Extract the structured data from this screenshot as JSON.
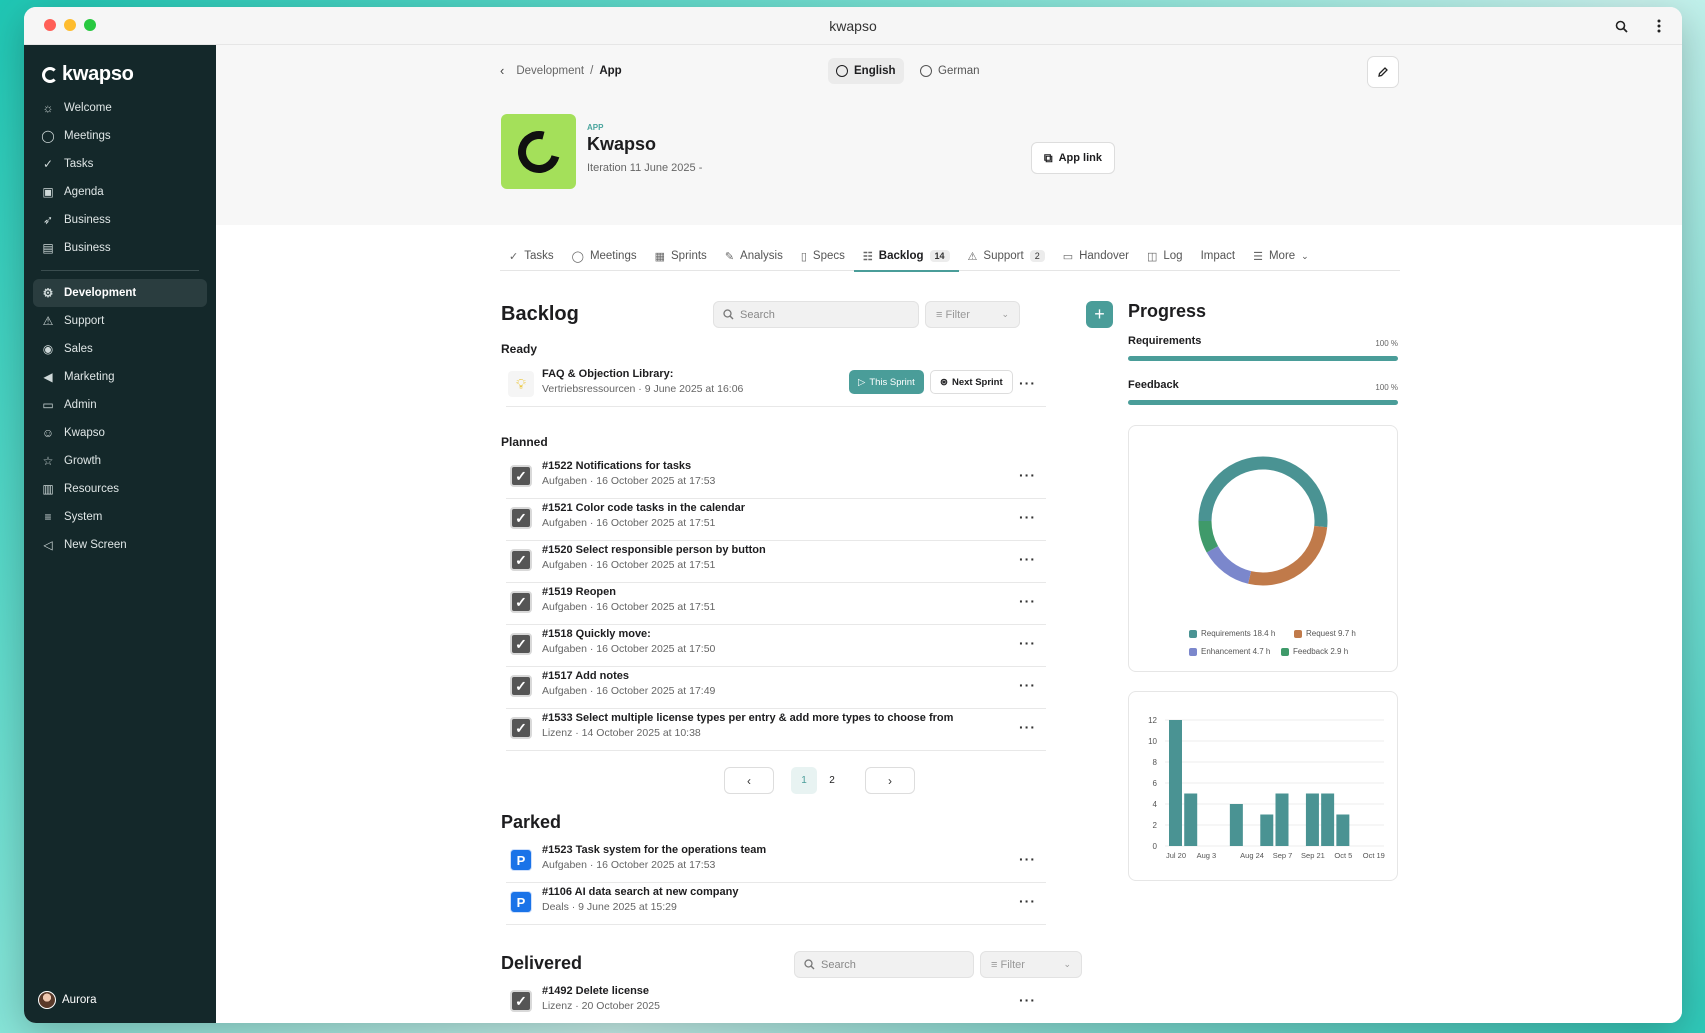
{
  "window": {
    "title": "kwapso"
  },
  "colors": {
    "accent": "#4a9d99",
    "sidebar": "#14282a",
    "app_logo_bg": "#a4e05a"
  },
  "sidebar": {
    "logo": "kwapso",
    "items": [
      {
        "label": "Welcome",
        "icon": "sun-icon"
      },
      {
        "label": "Meetings",
        "icon": "chat-bubble-icon"
      },
      {
        "label": "Tasks",
        "icon": "check-circle-icon"
      },
      {
        "label": "Agenda",
        "icon": "agenda-icon"
      },
      {
        "label": "Business",
        "icon": "rocket-icon"
      },
      {
        "label": "Business",
        "icon": "briefcase-icon"
      }
    ],
    "items2": [
      {
        "label": "Development",
        "icon": "gear-icon",
        "active": true
      },
      {
        "label": "Support",
        "icon": "warning-icon"
      },
      {
        "label": "Sales",
        "icon": "broadcast-icon"
      },
      {
        "label": "Marketing",
        "icon": "megaphone-icon"
      },
      {
        "label": "Admin",
        "icon": "folder-icon"
      },
      {
        "label": "Kwapso",
        "icon": "smiley-icon"
      },
      {
        "label": "Growth",
        "icon": "star-icon"
      },
      {
        "label": "Resources",
        "icon": "archive-icon"
      },
      {
        "label": "System",
        "icon": "sliders-icon"
      },
      {
        "label": "New Screen",
        "icon": "speaker-icon"
      }
    ],
    "user": "Aurora"
  },
  "header": {
    "breadcrumb": {
      "parent": "Development",
      "sep": "/",
      "current": "App"
    },
    "languages": [
      "English",
      "German"
    ],
    "app_tag": "APP",
    "app_name": "Kwapso",
    "iteration": "Iteration 11 June 2025 -",
    "app_link": "App link"
  },
  "tabs": [
    {
      "label": "Tasks",
      "icon": "check-circle-icon"
    },
    {
      "label": "Meetings",
      "icon": "chat-bubble-icon"
    },
    {
      "label": "Sprints",
      "icon": "calendar-icon"
    },
    {
      "label": "Analysis",
      "icon": "pencil-icon"
    },
    {
      "label": "Specs",
      "icon": "clipboard-icon"
    },
    {
      "label": "Backlog",
      "icon": "list-check-icon",
      "badge": "14",
      "active": true
    },
    {
      "label": "Support",
      "icon": "warning-icon",
      "badge": "2"
    },
    {
      "label": "Handover",
      "icon": "book-icon"
    },
    {
      "label": "Log",
      "icon": "comment-icon"
    },
    {
      "label": "Impact",
      "icon": ""
    },
    {
      "label": "More",
      "icon": "menu-icon"
    }
  ],
  "backlog": {
    "title": "Backlog",
    "search_placeholder": "Search",
    "filter_label": "Filter",
    "ready_label": "Ready",
    "ready": [
      {
        "title": "FAQ & Objection Library:",
        "sub": "Vertriebsressourcen · 9 June 2025 at 16:06",
        "this_sprint": "This Sprint",
        "next_sprint": "Next Sprint"
      }
    ],
    "planned_label": "Planned",
    "planned": [
      {
        "title": "#1522 Notifications for tasks",
        "sub": "Aufgaben · 16 October 2025 at 17:53"
      },
      {
        "title": "#1521 Color code tasks in the calendar",
        "sub": "Aufgaben · 16 October 2025 at 17:51"
      },
      {
        "title": "#1520 Select responsible person by button",
        "sub": "Aufgaben · 16 October 2025 at 17:51"
      },
      {
        "title": "#1519 Reopen",
        "sub": "Aufgaben · 16 October 2025 at 17:51"
      },
      {
        "title": "#1518 Quickly move:",
        "sub": "Aufgaben · 16 October 2025 at 17:50"
      },
      {
        "title": "#1517 Add notes",
        "sub": "Aufgaben · 16 October 2025 at 17:49"
      },
      {
        "title": "#1533 Select multiple license types per entry & add more types to choose from",
        "sub": "Lizenz · 14 October 2025 at 10:38"
      }
    ],
    "pages": [
      "1",
      "2"
    ],
    "parked_label": "Parked",
    "parked": [
      {
        "title": "#1523 Task system for the operations team",
        "sub": "Aufgaben · 16 October 2025 at 17:53"
      },
      {
        "title": "#1106 AI data search at new company",
        "sub": "Deals · 9 June 2025 at 15:29"
      }
    ],
    "delivered_label": "Delivered",
    "delivered_search": "Search",
    "delivered_filter": "Filter",
    "delivered": [
      {
        "title": "#1492 Delete license",
        "sub": "Lizenz · 20 October 2025"
      }
    ]
  },
  "progress": {
    "title": "Progress",
    "bars": [
      {
        "label": "Requirements",
        "value": "100 %",
        "fraction": 1.0
      },
      {
        "label": "Feedback",
        "value": "100 %",
        "fraction": 1.0
      }
    ]
  },
  "chart_data": [
    {
      "type": "pie",
      "donut": true,
      "slices": [
        {
          "name": "Requirements 18.4 h",
          "value": 18.4,
          "color": "#4a9393"
        },
        {
          "name": "Request 9.7 h",
          "value": 9.7,
          "color": "#c07a4a"
        },
        {
          "name": "Enhancement 4.7 h",
          "value": 4.7,
          "color": "#7b87cc"
        },
        {
          "name": "Feedback 2.9 h",
          "value": 2.9,
          "color": "#3f9a6a"
        }
      ]
    },
    {
      "type": "bar",
      "x": [
        "Jul 20",
        "Jul 27",
        "Aug 3",
        "Aug 10",
        "Aug 17",
        "Aug 24",
        "Aug 31",
        "Sep 7",
        "Sep 14",
        "Sep 21",
        "Sep 28",
        "Oct 5",
        "Oct 12",
        "Oct 19"
      ],
      "tick_labels": [
        "Jul 20",
        "",
        "Aug 3",
        "",
        "",
        "Aug 24",
        "",
        "Sep 7",
        "",
        "Sep 21",
        "",
        "Oct 5",
        "",
        "Oct 19"
      ],
      "values": [
        12,
        5,
        0,
        0,
        4,
        0,
        3,
        5,
        0,
        5,
        5,
        3,
        0,
        0
      ],
      "ylim": [
        0,
        12
      ],
      "yticks": [
        "0",
        "2",
        "4",
        "6",
        "8",
        "10",
        "12"
      ],
      "grid": true,
      "color": "#4a9393"
    }
  ]
}
